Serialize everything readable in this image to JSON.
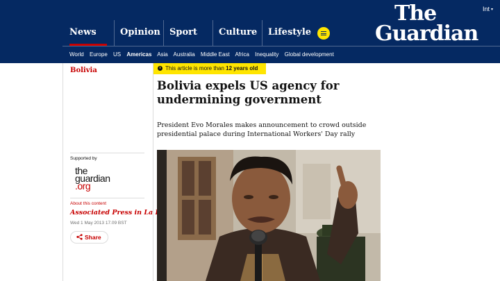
{
  "header": {
    "edition": "Int",
    "logo_line1": "The",
    "logo_line2": "Guardian",
    "pillars": [
      "News",
      "Opinion",
      "Sport",
      "Culture",
      "Lifestyle"
    ],
    "subnav": [
      "World",
      "Europe",
      "US",
      "Americas",
      "Asia",
      "Australia",
      "Middle East",
      "Africa",
      "Inequality",
      "Global development"
    ],
    "active_subnav": "Americas"
  },
  "article": {
    "section": "Bolivia",
    "age_warning_prefix": "This article is more than ",
    "age_warning_bold": "12 years old",
    "headline": "Bolivia expels US agency for undermining government",
    "standfirst": "President Evo Morales makes announcement to crowd outside presidential palace during International Workers' Day rally",
    "supported_by": "Supported by",
    "supporter_logo": [
      "the",
      "guardian",
      ".org"
    ],
    "about_content": "About this content",
    "byline": "Associated Press in La Paz",
    "date": "Wed 1 May 2013 17.09 BST",
    "share_label": "Share"
  },
  "colors": {
    "masthead": "#052962",
    "news_red": "#c70000",
    "warning_yellow": "#ffe500"
  },
  "icons": [
    "menu-icon",
    "clock-icon",
    "share-icon",
    "chevron-down-icon"
  ]
}
